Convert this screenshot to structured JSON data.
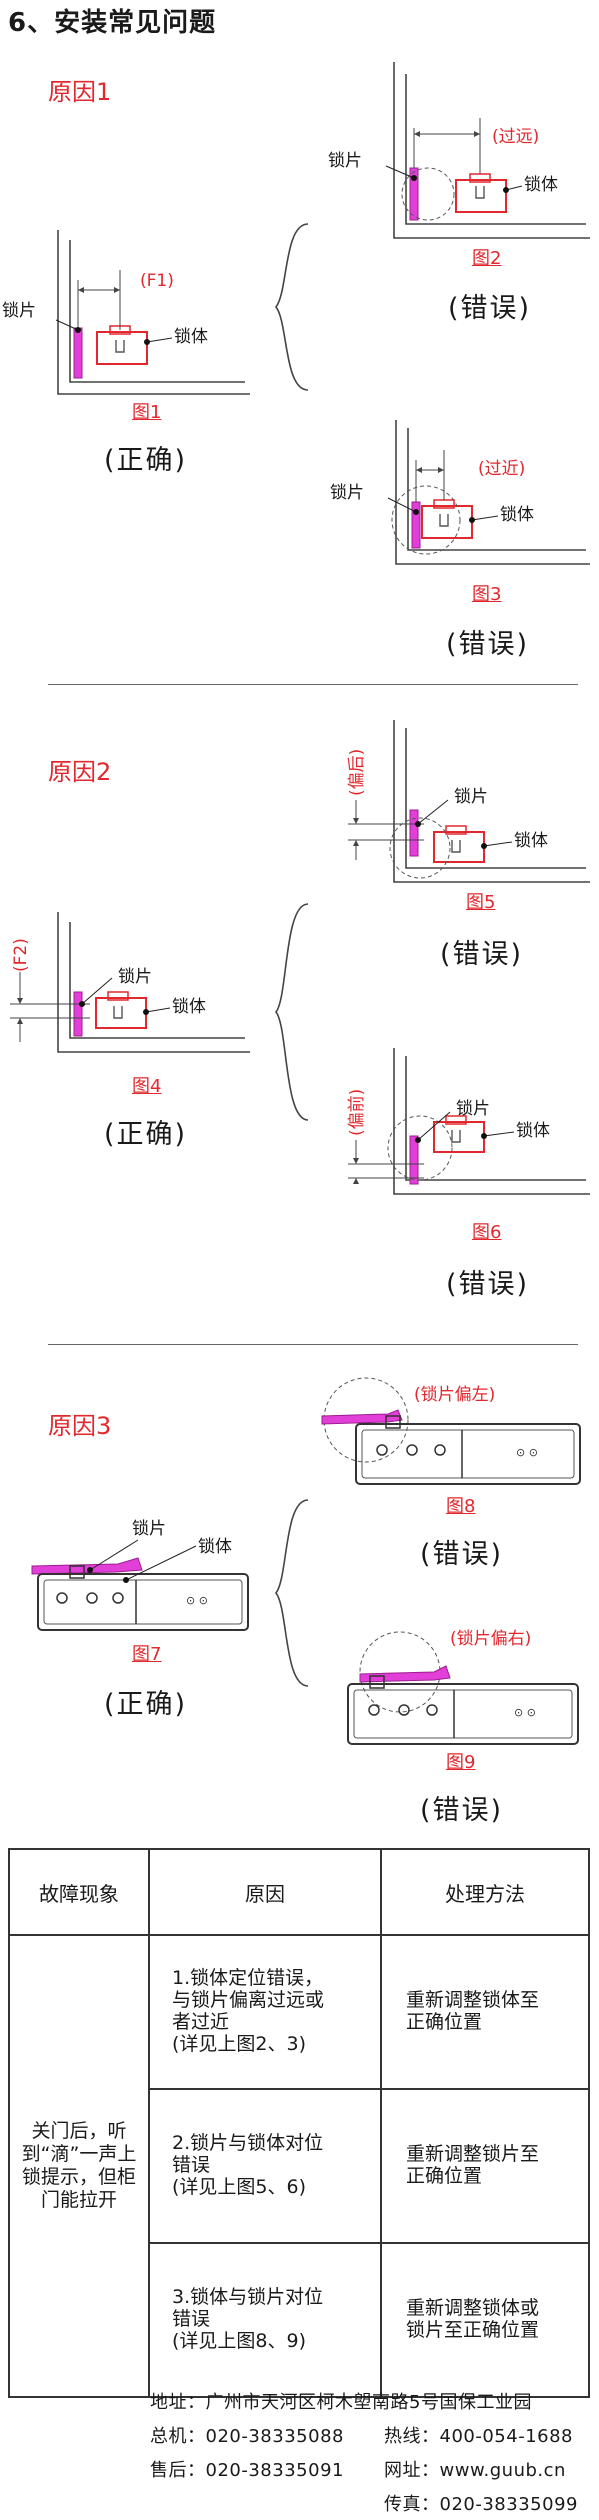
{
  "page_title": "6、安装常见问题",
  "sections": [
    {
      "reason": "原因1",
      "correct": {
        "fig": "图1",
        "verdict": "(正确)",
        "dim": "(F1)"
      },
      "wrong": [
        {
          "fig": "图2",
          "verdict": "(错误)",
          "dim": "(过远)"
        },
        {
          "fig": "图3",
          "verdict": "(错误)",
          "dim": "(过近)"
        }
      ]
    },
    {
      "reason": "原因2",
      "correct": {
        "fig": "图4",
        "verdict": "(正确)",
        "dim": "(F2)"
      },
      "wrong": [
        {
          "fig": "图5",
          "verdict": "(错误)",
          "dim": "(偏后)"
        },
        {
          "fig": "图6",
          "verdict": "(错误)",
          "dim": "(偏前)"
        }
      ]
    },
    {
      "reason": "原因3",
      "correct": {
        "fig": "图7",
        "verdict": "(正确)"
      },
      "wrong": [
        {
          "fig": "图8",
          "verdict": "(错误)",
          "dim": "(锁片偏左)"
        },
        {
          "fig": "图9",
          "verdict": "(错误)",
          "dim": "(锁片偏右)"
        }
      ]
    }
  ],
  "part_labels": {
    "plate": "锁片",
    "body": "锁体"
  },
  "table": {
    "headers": [
      "故障现象",
      "原因",
      "处理方法"
    ],
    "symptom": "关门后，听到“滴”一声上锁提示，但柜门能拉开",
    "rows": [
      {
        "cause_lines": [
          "1.锁体定位错误，",
          "与锁片偏离过远或",
          "者过近",
          "(详见上图2、3)"
        ],
        "fix_lines": [
          "重新调整锁体至",
          "正确位置"
        ]
      },
      {
        "cause_lines": [
          "2.锁片与锁体对位",
          "错误",
          "(详见上图5、6)"
        ],
        "fix_lines": [
          "重新调整锁片至",
          "正确位置"
        ]
      },
      {
        "cause_lines": [
          "3.锁体与锁片对位",
          "错误",
          "(详见上图8、9)"
        ],
        "fix_lines": [
          "重新调整锁体或",
          "锁片至正确位置"
        ]
      }
    ]
  },
  "footer": {
    "address": "地址：广州市天河区柯木塱南路5号国保工业园",
    "phone": "总机：020-38335088",
    "hotline": "热线：400-054-1688",
    "service": "售后：020-38335091",
    "website": "网址：www.guub.cn",
    "fax": "传真：020-38335099"
  }
}
